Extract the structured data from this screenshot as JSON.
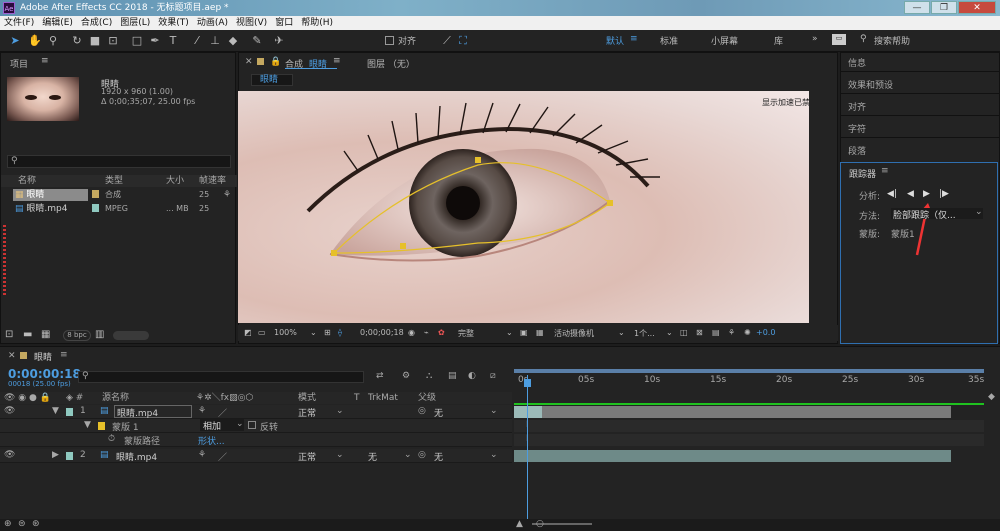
{
  "app": {
    "title": "Adobe After Effects CC 2018 - 无标题项目.aep *",
    "logo": "Ae"
  },
  "menu": [
    "文件(F)",
    "编辑(E)",
    "合成(C)",
    "图层(L)",
    "效果(T)",
    "动画(A)",
    "视图(V)",
    "窗口",
    "帮助(H)"
  ],
  "toolbar": {
    "snap_label": "对齐",
    "workspaces": [
      "默认",
      "标准",
      "小屏幕",
      "库"
    ],
    "search_placeholder": "搜索帮助"
  },
  "project": {
    "title": "项目",
    "item_name": "眼睛",
    "item_info1": "1920 x 960 (1.00)",
    "item_info2": "Δ 0;00;35;07, 25.00 fps",
    "cols": [
      "名称",
      "类型",
      "大小",
      "帧速率"
    ],
    "rows": [
      {
        "name": "眼睛",
        "type": "合成",
        "size": "",
        "fps": "25"
      },
      {
        "name": "眼睛.mp4",
        "type": "MPEG",
        "size": "... MB",
        "fps": "25"
      }
    ],
    "bpc": "8 bpc"
  },
  "viewer": {
    "tab_comp": "合成",
    "comp_name": "眼睛",
    "tab_layer": "图层 （无）",
    "sub_tab": "眼睛",
    "accel_note": "显示加速已禁用",
    "zoom": "100%",
    "time": "0;00;00;18",
    "quality": "完整",
    "camera": "活动摄像机",
    "views": "1个...",
    "exposure": "+0.0"
  },
  "right": {
    "items": [
      "信息",
      "效果和预设",
      "对齐",
      "字符",
      "段落"
    ],
    "tracker": {
      "title": "跟踪器",
      "analyze": "分析:",
      "method_label": "方法:",
      "method_value": "脸部跟踪（仅...",
      "mask_label": "蒙版:",
      "mask_value": "蒙版1"
    }
  },
  "timeline": {
    "comp_name": "眼睛",
    "timecode": "0:00:00:18",
    "frames": "00018 (25.00 fps)",
    "header": {
      "source": "源名称",
      "mode": "模式",
      "t": "T",
      "trkmat": "TrkMat",
      "parent": "父级"
    },
    "ruler": [
      "0s",
      "05s",
      "10s",
      "15s",
      "20s",
      "25s",
      "30s",
      "35s"
    ],
    "layers": [
      {
        "num": "1",
        "name": "眼睛.mp4",
        "mode": "正常",
        "trk": "",
        "parent": "无"
      },
      {
        "num": "2",
        "name": "眼睛.mp4",
        "mode": "正常",
        "trk": "无",
        "parent": "无"
      }
    ],
    "mask": {
      "name": "蒙版 1",
      "mode": "相加",
      "invert": "反转",
      "path_label": "蒙版路径",
      "path_value": "形状..."
    }
  },
  "colors": {
    "accent": "#4d9de0",
    "mask": "#e6c02a",
    "panel": "#232323",
    "green": "#1fc21f"
  }
}
